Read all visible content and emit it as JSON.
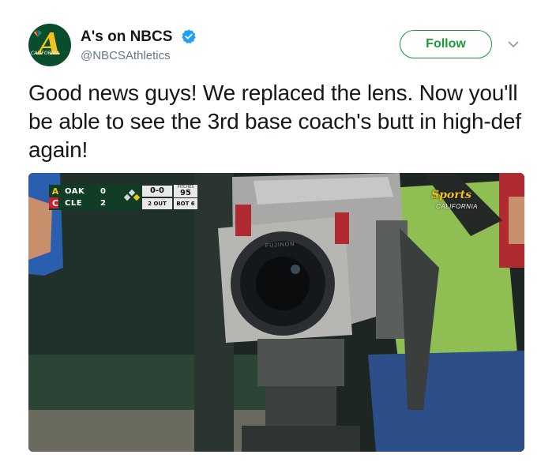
{
  "account": {
    "name": "A's on NBCS",
    "handle": "@NBCSAthletics",
    "avatar_text": "A",
    "avatar_sub": "CALIFORNIA",
    "verified": true
  },
  "actions": {
    "follow_label": "Follow",
    "more_icon": "chevron-down-icon"
  },
  "tweet": {
    "text": "Good news guys! We replaced the lens. Now you'll be able to see the 3rd base coach's butt in high-def again!"
  },
  "media": {
    "scorebug": {
      "teams": [
        {
          "logo": "A",
          "abbr": "OAK",
          "score": "0"
        },
        {
          "logo": "C",
          "abbr": "CLE",
          "score": "2"
        }
      ],
      "count": "0-0",
      "outs": "2 OUT",
      "pitches_label": "PITCHES",
      "pitches": "95",
      "inning": "BOT 6"
    },
    "network_logo": "Sports",
    "network_sub": "CALIFORNIA",
    "camera_brand": "FUJINON"
  },
  "colors": {
    "follow_green": "#1b9b3a",
    "verified_blue": "#1da1f2",
    "handle_gray": "#657786",
    "text": "#14171a"
  }
}
